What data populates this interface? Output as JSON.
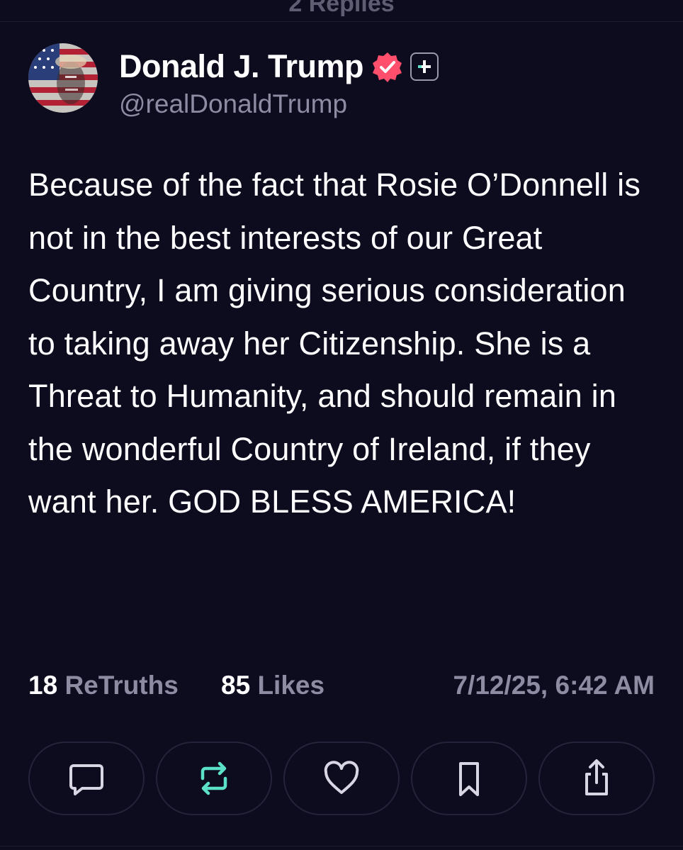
{
  "thread": {
    "replies_label": "2 Replies"
  },
  "post": {
    "author": {
      "display_name": "Donald J. Trump",
      "handle": "@realDonaldTrump",
      "avatar_icon": "flag-portrait-avatar",
      "verified_icon": "verified-badge-icon",
      "verified_color": "#ff4f6d",
      "follow_icon": "plus-icon"
    },
    "body": "Because of the fact that Rosie O’Donnell is not in the best interests of our Great Country, I am giving serious consideration to taking away her Citizenship. She is a Threat to Humanity, and should remain in the wonderful Country of Ireland, if they want her. GOD BLESS AMERICA!",
    "stats": {
      "retruths_count": "18",
      "retruths_label": "ReTruths",
      "likes_count": "85",
      "likes_label": "Likes",
      "timestamp": "7/12/25, 6:42 AM"
    },
    "actions": [
      {
        "name": "reply",
        "icon": "comment-icon"
      },
      {
        "name": "retruth",
        "icon": "retruth-icon",
        "color": "#5ce1c9"
      },
      {
        "name": "like",
        "icon": "heart-icon"
      },
      {
        "name": "bookmark",
        "icon": "bookmark-icon"
      },
      {
        "name": "share",
        "icon": "share-icon"
      }
    ]
  },
  "colors": {
    "background": "#0d0b1e",
    "muted_text": "#8e8ca3",
    "button_border": "#25233a",
    "accent_teal": "#5ce1c9",
    "badge_pink": "#ff4f6d"
  }
}
